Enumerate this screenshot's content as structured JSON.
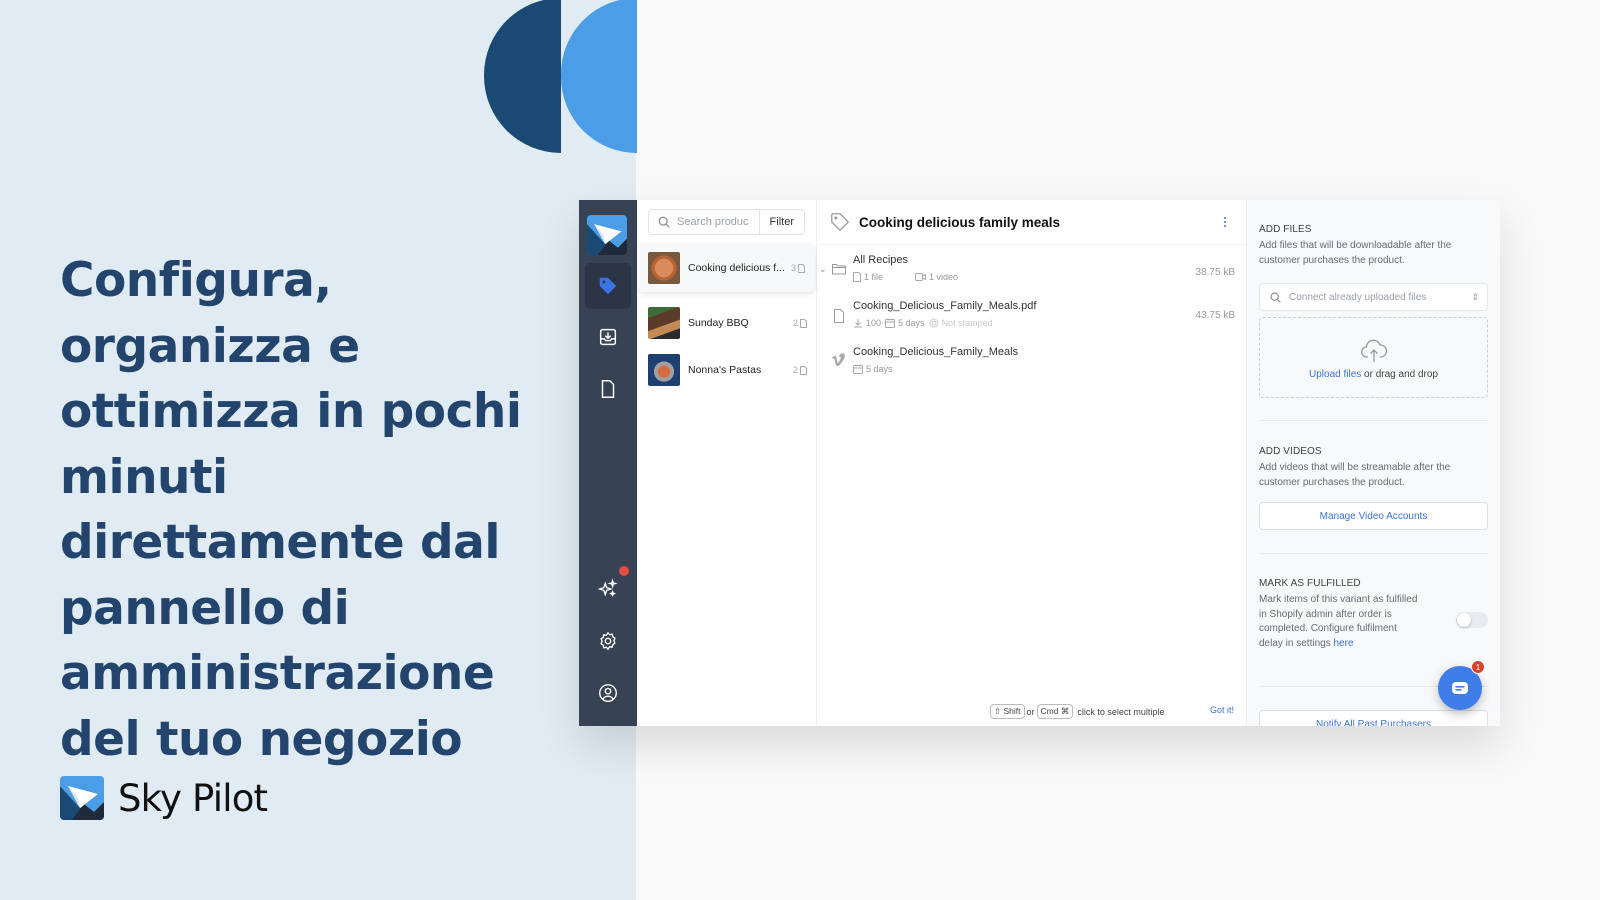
{
  "marketing": {
    "headline": "Configura, organizza e ottimizza in pochi minuti direttamente dal pannello di amministrazione del tuo negozio",
    "brand_name": "Sky Pilot",
    "colors": {
      "headline": "#23456d",
      "deco_dark": "#1a4a73",
      "deco_light": "#4a9de6",
      "left_bg": "#e1ebf3"
    }
  },
  "app": {
    "nav": {
      "items": [
        {
          "name": "products",
          "icon": "tag-icon",
          "active": true
        },
        {
          "name": "orders",
          "icon": "inbox-download-icon",
          "active": false
        },
        {
          "name": "files",
          "icon": "file-icon",
          "active": false
        },
        {
          "name": "whats-new",
          "icon": "sparkles-icon",
          "active": false,
          "notification": true
        },
        {
          "name": "settings",
          "icon": "gear-icon",
          "active": false
        },
        {
          "name": "account",
          "icon": "user-circle-icon",
          "active": false
        }
      ]
    },
    "products": {
      "search_placeholder": "Search produc",
      "filter_label": "Filter",
      "items": [
        {
          "name": "Cooking delicious f...",
          "count": "3",
          "active": true
        },
        {
          "name": "Sunday BBQ",
          "count": "2",
          "active": false
        },
        {
          "name": "Nonna's Pastas",
          "count": "2",
          "active": false
        }
      ]
    },
    "main": {
      "title": "Cooking delicious family meals",
      "rows": [
        {
          "name": "All Recipes",
          "type": "folder",
          "meta": {
            "files": "1 file",
            "videos": "1 video"
          },
          "size": "38.75 kB"
        },
        {
          "name": "Cooking_Delicious_Family_Meals.pdf",
          "type": "file",
          "meta": {
            "downloads": "100",
            "expiry": "5 days",
            "stamp": "Not stamped"
          },
          "size": "43.75 kB"
        },
        {
          "name": "Cooking_Delicious_Family_Meals",
          "type": "vimeo",
          "meta": {
            "expiry": "5 days"
          },
          "size": ""
        }
      ],
      "hint": {
        "key1": "⇧ Shift",
        "or": "or",
        "key2": "Cmd ⌘",
        "text": "click to select multiple",
        "dismiss": "Got it!"
      }
    },
    "side": {
      "add_files": {
        "title": "ADD FILES",
        "desc": "Add files that will be downloadable after the customer purchases the product.",
        "connect_placeholder": "Connect already uploaded files",
        "upload_link": "Upload files",
        "upload_rest": " or drag and drop"
      },
      "add_videos": {
        "title": "ADD VIDEOS",
        "desc": "Add videos that will be streamable after the customer purchases the product.",
        "button": "Manage Video Accounts"
      },
      "fulfilled": {
        "title": "MARK AS FULFILLED",
        "desc": "Mark items of this variant as fulfilled in Shopify admin after order is completed. Configure fulfilment delay in settings ",
        "link": "here",
        "toggle_on": false
      },
      "notify_button": "Notify All Past Purchasers"
    },
    "chat": {
      "badge": "1"
    },
    "colors": {
      "accent": "#3b72e4",
      "nav_bg": "#374255"
    }
  }
}
